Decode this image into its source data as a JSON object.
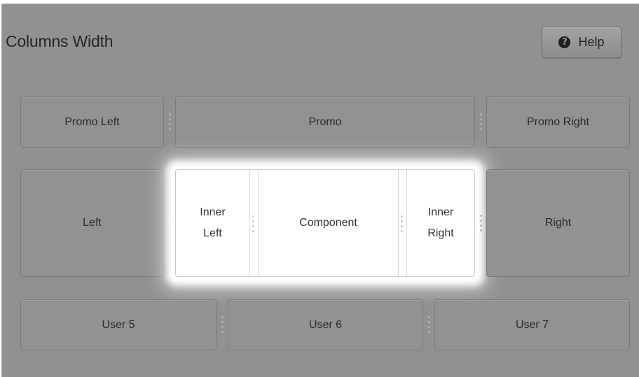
{
  "header": {
    "title": "Columns Width",
    "help_label": "Help",
    "help_icon": "question-circle-icon"
  },
  "layout": {
    "row1": {
      "promo_left": "Promo Left",
      "promo": "Promo",
      "promo_right": "Promo Right"
    },
    "row2": {
      "left": "Left",
      "inner_left": "Inner Left",
      "component": "Component",
      "inner_right": "Inner Right",
      "right": "Right"
    },
    "row3": {
      "user5": "User 5",
      "user6": "User 6",
      "user7": "User 7"
    }
  },
  "colors": {
    "overlay": "#919191",
    "highlight": "#ffffff"
  }
}
